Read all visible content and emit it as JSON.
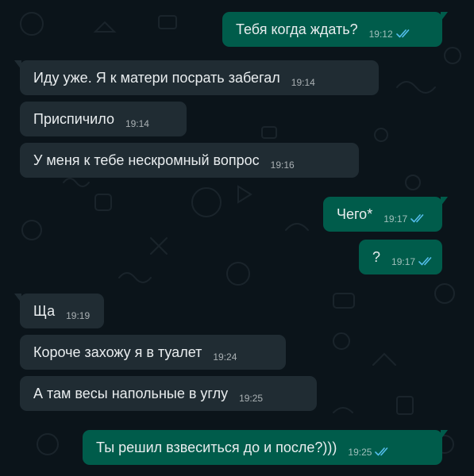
{
  "chat": {
    "messages": [
      {
        "dir": "out",
        "text": "Тебя когда ждать?",
        "time": "19:12",
        "status": "read"
      },
      {
        "dir": "in",
        "text": "Иду уже. Я к матери посрать забегал",
        "time": "19:14"
      },
      {
        "dir": "in",
        "text": "Приспичило",
        "time": "19:14"
      },
      {
        "dir": "in",
        "text": "У меня к тебе нескромный вопрос",
        "time": "19:16"
      },
      {
        "dir": "out",
        "text": "Чего*",
        "time": "19:17",
        "status": "read"
      },
      {
        "dir": "out",
        "text": "?",
        "time": "19:17",
        "status": "read"
      },
      {
        "dir": "in",
        "text": "Ща",
        "time": "19:19"
      },
      {
        "dir": "in",
        "text": "Короче захожу я в туалет",
        "time": "19:24"
      },
      {
        "dir": "in",
        "text": "А там весы напольные в углу",
        "time": "19:25"
      },
      {
        "dir": "out",
        "text": "Ты решил взвеситься до и после?)))",
        "time": "19:25",
        "status": "read"
      }
    ]
  },
  "colors": {
    "background": "#0b141a",
    "incoming_bubble": "#202c33",
    "outgoing_bubble": "#005c4b",
    "text": "#e9edef",
    "read_ticks": "#53bdeb"
  },
  "icons": {
    "read_receipt": "double-check-icon",
    "wallpaper": "doodle-pattern"
  }
}
